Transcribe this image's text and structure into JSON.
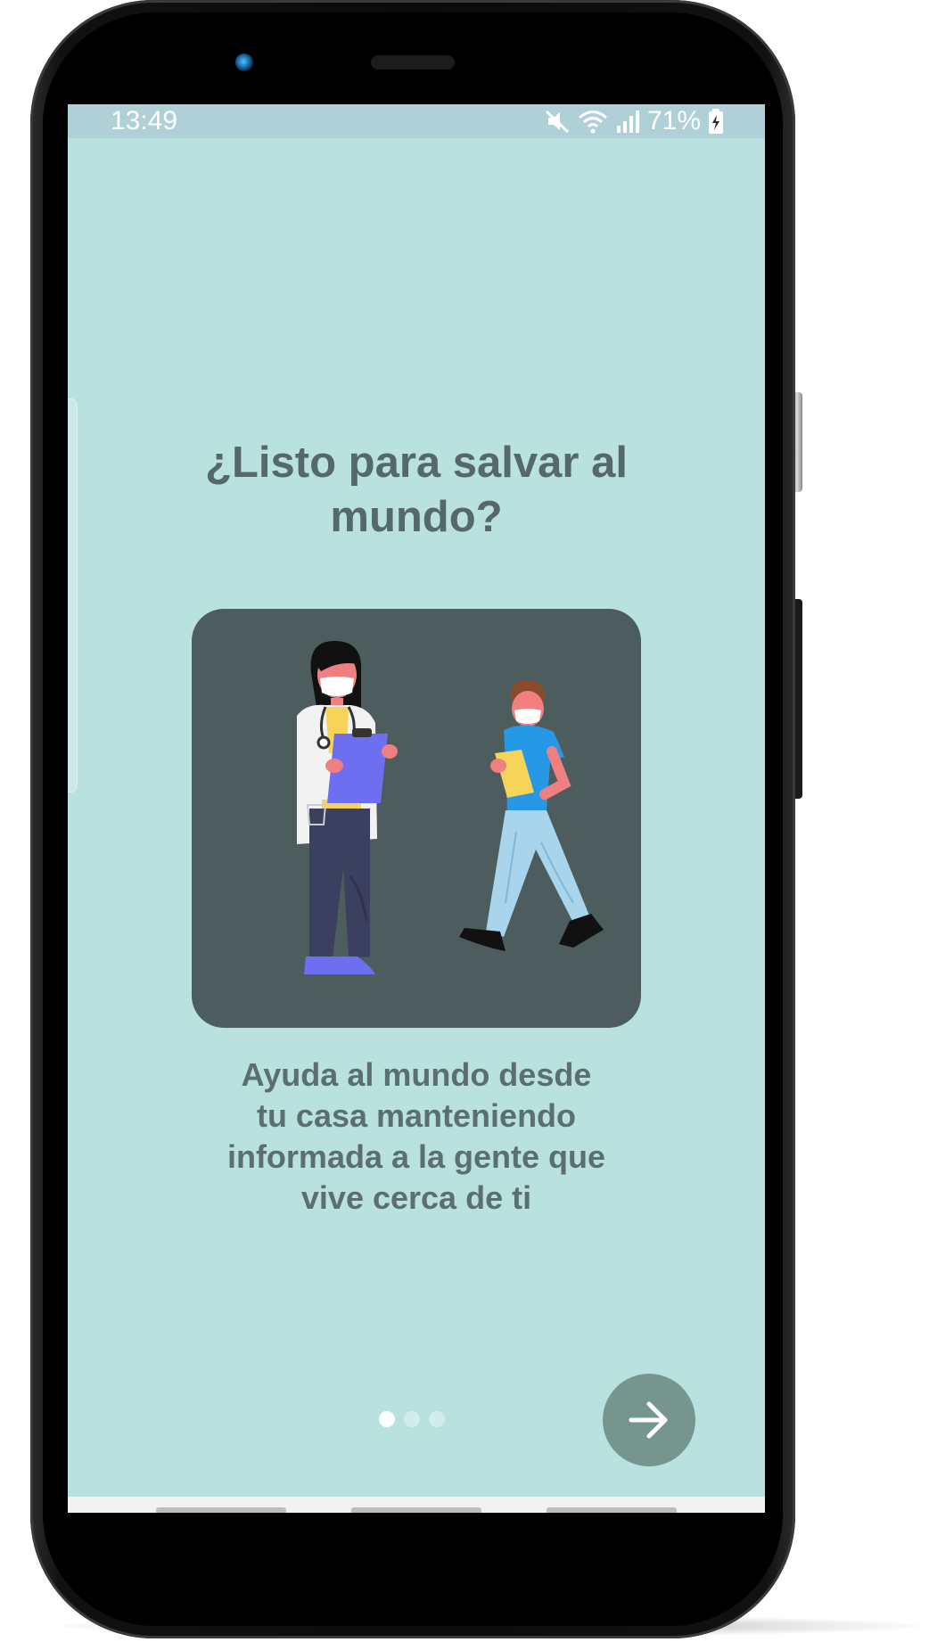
{
  "status_bar": {
    "time": "13:49",
    "battery_percent": "71%",
    "icons": [
      "mute-icon",
      "wifi-icon",
      "signal-icon",
      "battery-charging-icon"
    ]
  },
  "onboarding": {
    "title_lines": [
      "¿Listo para salvar al",
      "mundo?"
    ],
    "description_lines": [
      "Ayuda al mundo desde",
      "tu casa manteniendo",
      "informada a la gente que",
      "vive cerca de ti"
    ],
    "illustration": "doctor-and-nurse-with-masks",
    "page_indicator": {
      "current": 1,
      "total": 3
    },
    "next_button_icon": "arrow-right-icon"
  },
  "colors": {
    "screen_background": "#b9e2de",
    "status_bar_background": "#aed0d6",
    "text": "#55686a",
    "card_background": "#4d5c5c",
    "next_button": "#76958f"
  }
}
